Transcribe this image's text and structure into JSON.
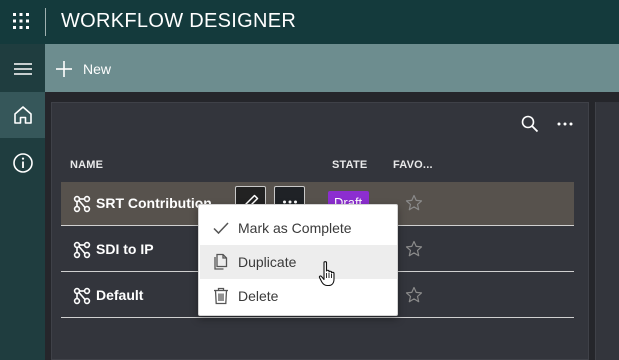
{
  "header": {
    "title": "WORKFLOW DESIGNER",
    "app_launcher_icon": "waffle-icon"
  },
  "left_nav": {
    "items": [
      {
        "name": "menu",
        "icon": "hamburger-icon"
      },
      {
        "name": "home",
        "icon": "home-icon",
        "selected": true
      },
      {
        "name": "info",
        "icon": "info-icon"
      }
    ]
  },
  "command_bar": {
    "new_label": "New"
  },
  "table": {
    "columns": {
      "name": "NAME",
      "state": "STATE",
      "favorite": "FAVO..."
    },
    "rows": [
      {
        "name": "SRT Contribution",
        "state": "Draft",
        "favorite": false,
        "selected": true
      },
      {
        "name": "SDI to IP",
        "state": "",
        "favorite": false
      },
      {
        "name": "Default",
        "state": "",
        "favorite": false
      }
    ]
  },
  "context_menu": {
    "items": [
      {
        "label": "Mark as Complete",
        "icon": "checkmark-icon"
      },
      {
        "label": "Duplicate",
        "icon": "copy-icon",
        "hovered": true
      },
      {
        "label": "Delete",
        "icon": "trash-icon"
      }
    ]
  },
  "colors": {
    "topbar": "#143a3c",
    "command_bar": "#6d8d8f",
    "draft_badge": "#8c2ed0",
    "selected_row": "#57524d"
  }
}
